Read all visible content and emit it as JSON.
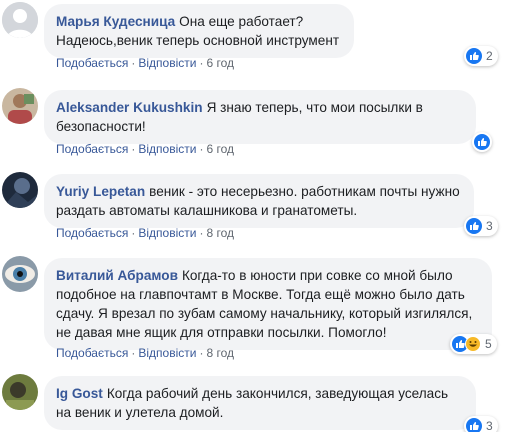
{
  "colors": {
    "author": "#385898",
    "bubble": "#f2f3f5",
    "like": "#1877f2",
    "haha": "#f7b928"
  },
  "actions": {
    "like": "Подобається",
    "reply": "Відповісти",
    "separator": "·"
  },
  "comments": [
    {
      "author": "Марья Кудесница",
      "text": "Она еще работает?Надеюсь,веник теперь основной инструмент",
      "time": "6 год",
      "reactions": [
        "like"
      ],
      "reaction_count": "2",
      "avatar_icon": "user-silhouette-icon"
    },
    {
      "author": "Aleksander Kukushkin",
      "text": "Я знаю теперь, что мои посылки в безопасности!",
      "time": "6 год",
      "reactions": [
        "like"
      ],
      "reaction_count": "",
      "avatar_icon": "user-photo-icon"
    },
    {
      "author": "Yuriy Lepetan",
      "text": "веник - это несерьезно. работникам почты нужно раздать автоматы калашникова и гранатометы.",
      "time": "8 год",
      "reactions": [
        "like"
      ],
      "reaction_count": "3",
      "avatar_icon": "user-photo-icon"
    },
    {
      "author": "Виталий Абрамов",
      "text": "Когда-то в юности при совке со мной было подобное на главпочтамт в Москве. Тогда ещё можно было дать сдачу. Я врезал по зубам самому начальнику, который изгилялся, не давая мне ящик для отправки посылки. Помогло!",
      "time": "8 год",
      "reactions": [
        "like",
        "haha"
      ],
      "reaction_count": "5",
      "avatar_icon": "eye-photo-icon"
    },
    {
      "author": "Ig Gost",
      "text": "Когда рабочий день закончился, заведующая уселась на веник и улетела домой.",
      "time": "",
      "reactions": [
        "like"
      ],
      "reaction_count": "3",
      "avatar_icon": "user-photo-icon"
    }
  ]
}
